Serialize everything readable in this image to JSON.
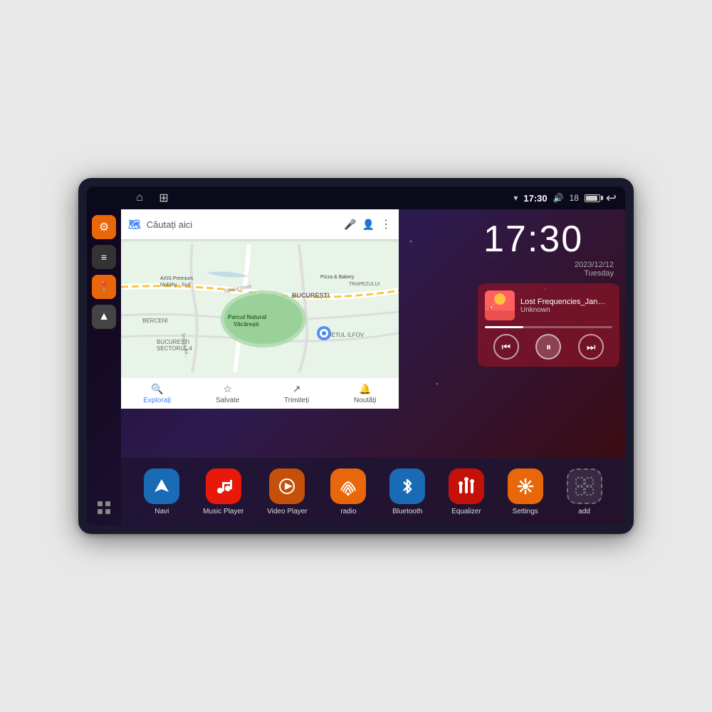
{
  "device": {
    "statusBar": {
      "time": "17:30",
      "battery": "18",
      "homeIcon": "⌂",
      "appsIcon": "⊞",
      "backIcon": "↩"
    },
    "clock": {
      "time": "17:30",
      "date": "2023/12/12",
      "day": "Tuesday"
    },
    "music": {
      "songTitle": "Lost Frequencies_Janie...",
      "artist": "Unknown",
      "albumArt": "🎵",
      "prevLabel": "⏮",
      "playLabel": "⏸",
      "nextLabel": "⏭"
    },
    "map": {
      "searchPlaceholder": "Căutați aici",
      "bottomItems": [
        {
          "label": "Explorați",
          "icon": "🔍",
          "active": true
        },
        {
          "label": "Salvate",
          "icon": "☆",
          "active": false
        },
        {
          "label": "Trimiteți",
          "icon": "↗",
          "active": false
        },
        {
          "label": "Noutăți",
          "icon": "🔔",
          "active": false
        }
      ],
      "labels": [
        "AXIS Premium Mobility - Sud",
        "Pizza & Bakery",
        "Parcul Natural Văcărești",
        "BUCUREȘTI",
        "BUCUREȘTI SECTORUL 4",
        "JUDETUL ILFOV",
        "BERCENI",
        "TRAPEZULUI"
      ]
    },
    "sidebar": {
      "items": [
        {
          "icon": "⚙",
          "color": "orange",
          "name": "settings"
        },
        {
          "icon": "▬",
          "color": "dark",
          "name": "menu"
        },
        {
          "icon": "📍",
          "color": "orange2",
          "name": "location"
        },
        {
          "icon": "▶",
          "color": "nav-arrow",
          "name": "navigation"
        }
      ]
    },
    "apps": [
      {
        "label": "Navi",
        "icon": "▶",
        "iconClass": "icon-navi",
        "name": "navi"
      },
      {
        "label": "Music Player",
        "icon": "♪",
        "iconClass": "icon-music",
        "name": "music-player"
      },
      {
        "label": "Video Player",
        "icon": "▶",
        "iconClass": "icon-video",
        "name": "video-player"
      },
      {
        "label": "radio",
        "icon": "📻",
        "iconClass": "icon-radio",
        "name": "radio"
      },
      {
        "label": "Bluetooth",
        "icon": "⚡",
        "iconClass": "icon-bt",
        "name": "bluetooth"
      },
      {
        "label": "Equalizer",
        "icon": "≡",
        "iconClass": "icon-eq",
        "name": "equalizer"
      },
      {
        "label": "Settings",
        "icon": "⚙",
        "iconClass": "icon-settings",
        "name": "settings-app"
      },
      {
        "label": "add",
        "icon": "+",
        "iconClass": "icon-add",
        "name": "add-app"
      }
    ]
  }
}
